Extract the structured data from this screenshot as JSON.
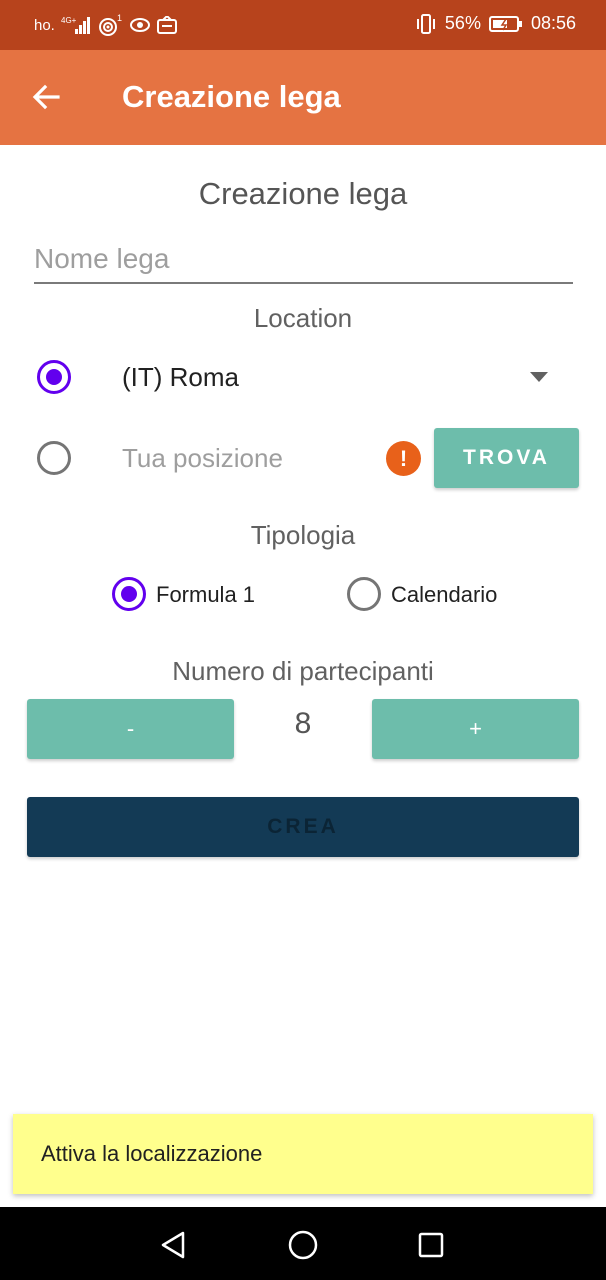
{
  "status_bar": {
    "carrier": "ho.",
    "network": "4G+",
    "wifi_badge": "1",
    "battery": "56%",
    "time": "08:56",
    "icons": [
      "signal-icon",
      "wifi-icon",
      "eye-icon",
      "message-icon",
      "vibrate-icon",
      "battery-icon"
    ]
  },
  "app_bar": {
    "title": "Creazione lega",
    "back_icon": "arrow-left-icon",
    "color": "#e57342"
  },
  "form": {
    "heading": "Creazione lega",
    "name_placeholder": "Nome lega",
    "name_value": "",
    "location": {
      "label": "Location",
      "selected_city": "(IT) Roma",
      "position_label": "Tua posizione",
      "find_button": "TROVA",
      "selected_option": "city"
    },
    "type": {
      "label": "Tipologia",
      "options": [
        "Formula 1",
        "Calendario"
      ],
      "selected": "Formula 1"
    },
    "participants": {
      "label": "Numero di partecipanti",
      "minus_label": "-",
      "plus_label": "+",
      "value": "8"
    },
    "create_button": "CREA"
  },
  "snackbar": {
    "message": "Attiva la localizzazione"
  },
  "colors": {
    "accent": "#6200ee",
    "teal": "#6dbdab",
    "navy": "#133a55",
    "warning": "#e8611a",
    "snackbar": "#ffff8d"
  }
}
